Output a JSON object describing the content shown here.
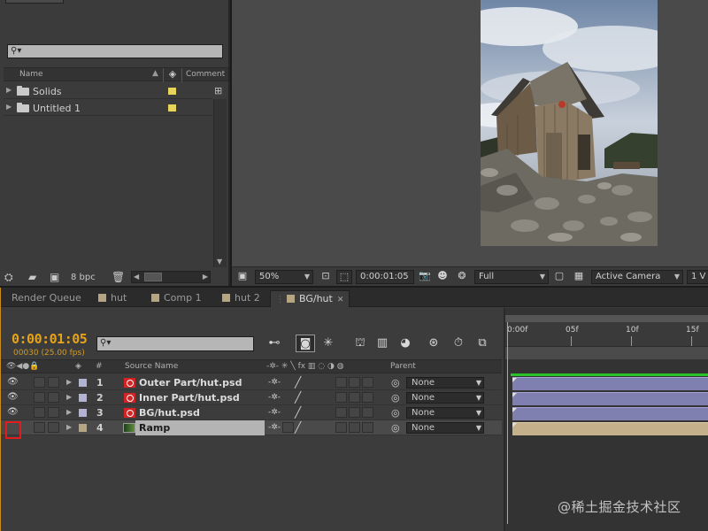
{
  "project": {
    "search_placeholder": "",
    "columns": {
      "name": "Name",
      "comment": "Comment"
    },
    "items": [
      {
        "label": "Solids",
        "type": "folder",
        "label_color": "#e6d55a"
      },
      {
        "label": "Untitled 1",
        "type": "folder",
        "label_color": "#e6d55a"
      }
    ],
    "bit_depth": "8 bpc"
  },
  "viewer": {
    "image_subject": "wooden hut on rocky hillside under cloudy sky",
    "zoom": "50%",
    "timecode": "0:00:01:05",
    "resolution": "Full",
    "camera": "Active Camera",
    "views": "1 V"
  },
  "timeline": {
    "tabs": [
      {
        "label": "Render Queue",
        "active": false
      },
      {
        "label": "hut",
        "active": false
      },
      {
        "label": "Comp 1",
        "active": false
      },
      {
        "label": "hut 2",
        "active": false
      },
      {
        "label": "BG/hut",
        "active": true
      }
    ],
    "timecode": "0:00:01:05",
    "frame_fps": "00030 (25.00 fps)",
    "search_placeholder": "",
    "columns": {
      "num": "#",
      "source_name": "Source Name",
      "parent": "Parent"
    },
    "layers": [
      {
        "num": "1",
        "name": "Outer Part/hut.psd",
        "type": "psd",
        "parent": "None",
        "visible": true,
        "label_color": "#b2b2d6"
      },
      {
        "num": "2",
        "name": "Inner Part/hut.psd",
        "type": "psd",
        "parent": "None",
        "visible": true,
        "label_color": "#b2b2d6"
      },
      {
        "num": "3",
        "name": "BG/hut.psd",
        "type": "psd",
        "parent": "None",
        "visible": true,
        "label_color": "#b2b2d6"
      },
      {
        "num": "4",
        "name": "Ramp",
        "type": "solid",
        "parent": "None",
        "visible": false,
        "selected": true,
        "label_color": "#b5a582"
      }
    ],
    "ruler": [
      "0:00f",
      "05f",
      "10f",
      "15f"
    ]
  },
  "colors": {
    "timecode": "#e6a318",
    "highlight": "#e01c1c",
    "psd_icon": "#d22424",
    "layer_bar": "#8080b0",
    "ramp_bar": "#c4b08a"
  },
  "watermark": "@稀土掘金技术社区"
}
